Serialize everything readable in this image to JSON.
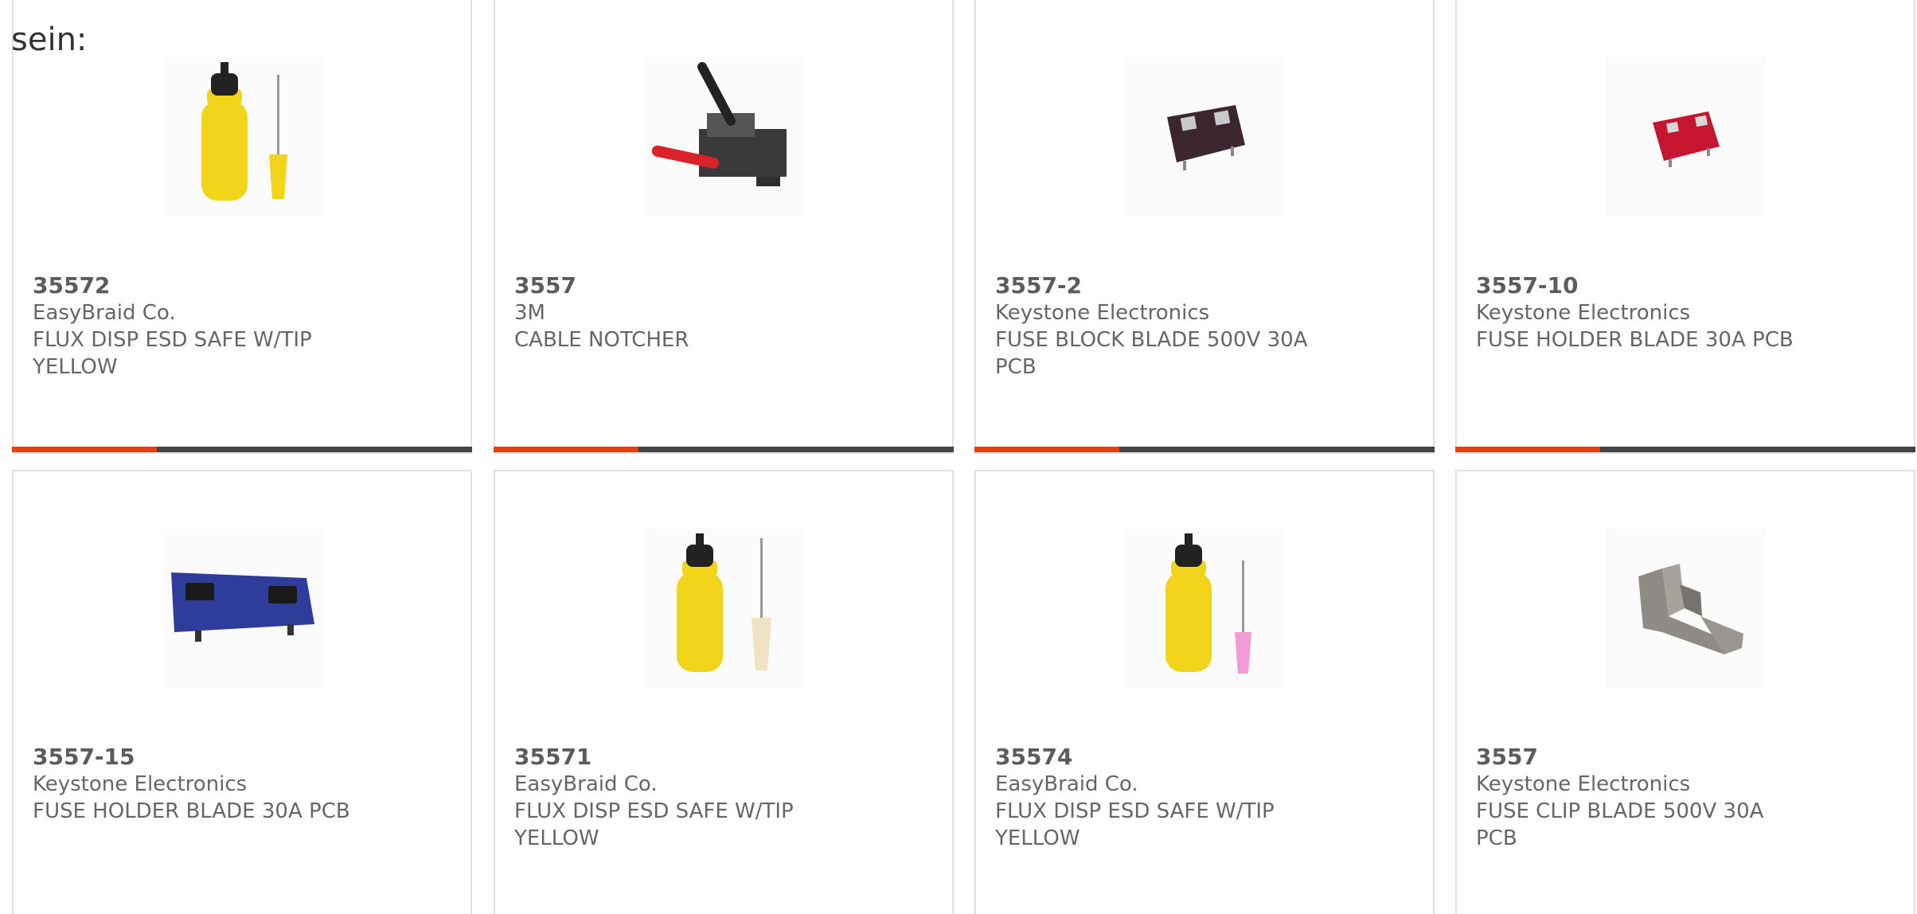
{
  "lead_text": "sein:",
  "accent_color": "#e8400c",
  "bar_color": "#444444",
  "products": [
    {
      "part_number": "35572",
      "manufacturer": "EasyBraid Co.",
      "description": "FLUX DISP ESD SAFE W/TIP YELLOW",
      "image": "yellow-flux-bottle-needle-icon",
      "highlight_fraction": 0.315
    },
    {
      "part_number": "3557",
      "manufacturer": "3M",
      "description": "CABLE NOTCHER",
      "image": "cable-notcher-tool-icon",
      "highlight_fraction": 0.315
    },
    {
      "part_number": "3557-2",
      "manufacturer": "Keystone Electronics",
      "description": "FUSE BLOCK BLADE 500V 30A PCB",
      "image": "brown-fuse-block-icon",
      "highlight_fraction": 0.315
    },
    {
      "part_number": "3557-10",
      "manufacturer": "Keystone Electronics",
      "description": "FUSE HOLDER BLADE 30A PCB",
      "image": "red-fuse-holder-icon",
      "highlight_fraction": 0.315
    },
    {
      "part_number": "3557-15",
      "manufacturer": "Keystone Electronics",
      "description": "FUSE HOLDER BLADE 30A PCB",
      "image": "blue-fuse-holder-icon"
    },
    {
      "part_number": "35571",
      "manufacturer": "EasyBraid Co.",
      "description": "FLUX DISP ESD SAFE W/TIP YELLOW",
      "image": "yellow-flux-bottle-clear-tip-icon"
    },
    {
      "part_number": "35574",
      "manufacturer": "EasyBraid Co.",
      "description": "FLUX DISP ESD SAFE W/TIP YELLOW",
      "image": "yellow-flux-bottle-pink-tip-icon"
    },
    {
      "part_number": "3557",
      "manufacturer": "Keystone Electronics",
      "description": "FUSE CLIP BLADE 500V 30A PCB",
      "image": "metal-fuse-clip-icon"
    }
  ]
}
